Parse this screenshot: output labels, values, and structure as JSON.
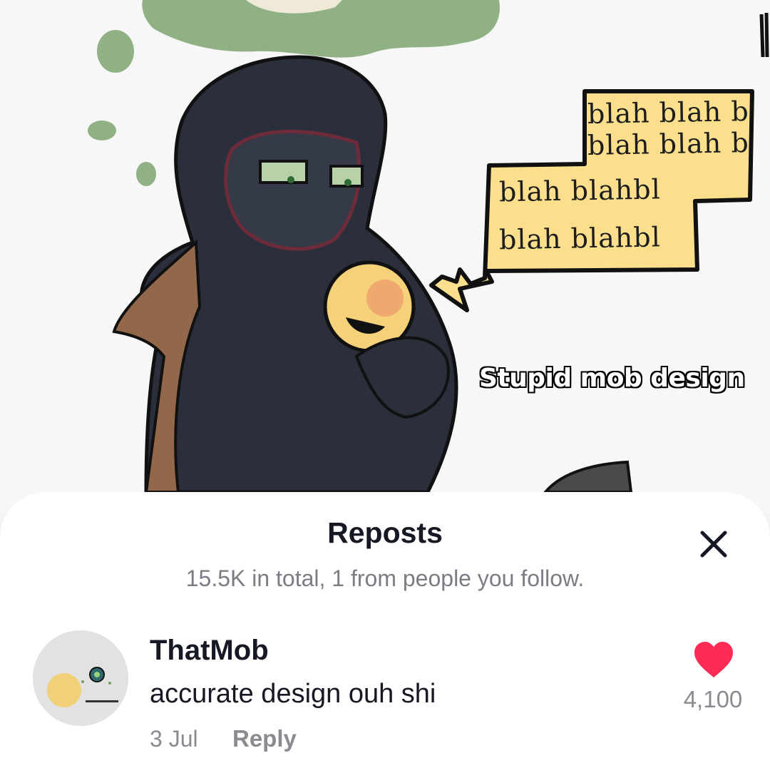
{
  "artwork": {
    "speech_lines": [
      "blah blah bl",
      "blah blah bl",
      "blah blahbl",
      "blah blahbl"
    ],
    "caption": "Stupid mob design"
  },
  "sheet": {
    "title": "Reposts",
    "subtitle": "15.5K in total, 1 from people you follow.",
    "close_icon": "close-icon"
  },
  "repost": {
    "username": "ThatMob",
    "comment": "accurate design ouh shi",
    "date": "3 Jul",
    "reply_label": "Reply",
    "like_count": "4,100",
    "like_icon": "heart-icon",
    "like_color": "#fe2c55"
  }
}
